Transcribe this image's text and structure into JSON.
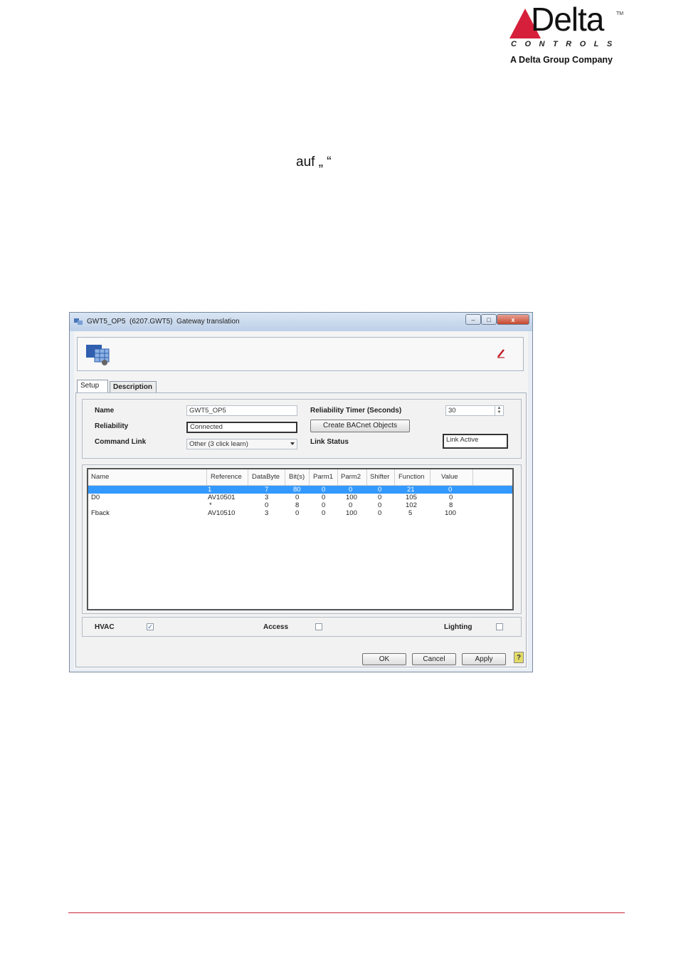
{
  "logo": {
    "wordmark": "Delta",
    "trademark": "TM",
    "tagline": "CONTROLS",
    "group": "A Delta Group Company",
    "brand_color": "#d61f3b"
  },
  "page_text": "auf „ “",
  "window": {
    "title": "GWT5_OP5  (6207.GWT5)  Gateway translation",
    "title_icon": "gateway-icon",
    "controls": {
      "minimize": "–",
      "maximize": "□",
      "close": "x"
    }
  },
  "tabs": [
    {
      "label": "Setup",
      "active": true
    },
    {
      "label": "Description",
      "active": false
    }
  ],
  "form": {
    "name_label": "Name",
    "name_value": "GWT5_OP5",
    "reliability_label": "Reliability",
    "reliability_value": "Connected",
    "command_link_label": "Command Link",
    "command_link_value": "Other (3 click learn)",
    "reliability_timer_label": "Reliability Timer (Seconds)",
    "reliability_timer_value": "30",
    "create_button": "Create BACnet Objects",
    "link_status_label": "Link Status",
    "link_status_value": "Link Active"
  },
  "table": {
    "columns": [
      "Name",
      "Reference",
      "DataByte",
      "Bit(s)",
      "Parm1",
      "Parm2",
      "Shifter",
      "Function",
      "Value"
    ],
    "rows": [
      [
        "",
        "1",
        "7",
        "80",
        "0",
        "0",
        "0",
        "21",
        "0"
      ],
      [
        "D0",
        "AV10501",
        "3",
        "0",
        "0",
        "100",
        "0",
        "105",
        "0"
      ],
      [
        "",
        "*",
        "0",
        "8",
        "0",
        "0",
        "0",
        "102",
        "8"
      ],
      [
        "Fback",
        "AV10510",
        "3",
        "0",
        "0",
        "100",
        "0",
        "5",
        "100"
      ]
    ],
    "selected_row": 0
  },
  "checkboxes": {
    "hvac_label": "HVAC",
    "hvac_checked": true,
    "access_label": "Access",
    "access_checked": false,
    "lighting_label": "Lighting",
    "lighting_checked": false
  },
  "buttons": {
    "ok": "OK",
    "cancel": "Cancel",
    "apply": "Apply",
    "help": "?"
  }
}
